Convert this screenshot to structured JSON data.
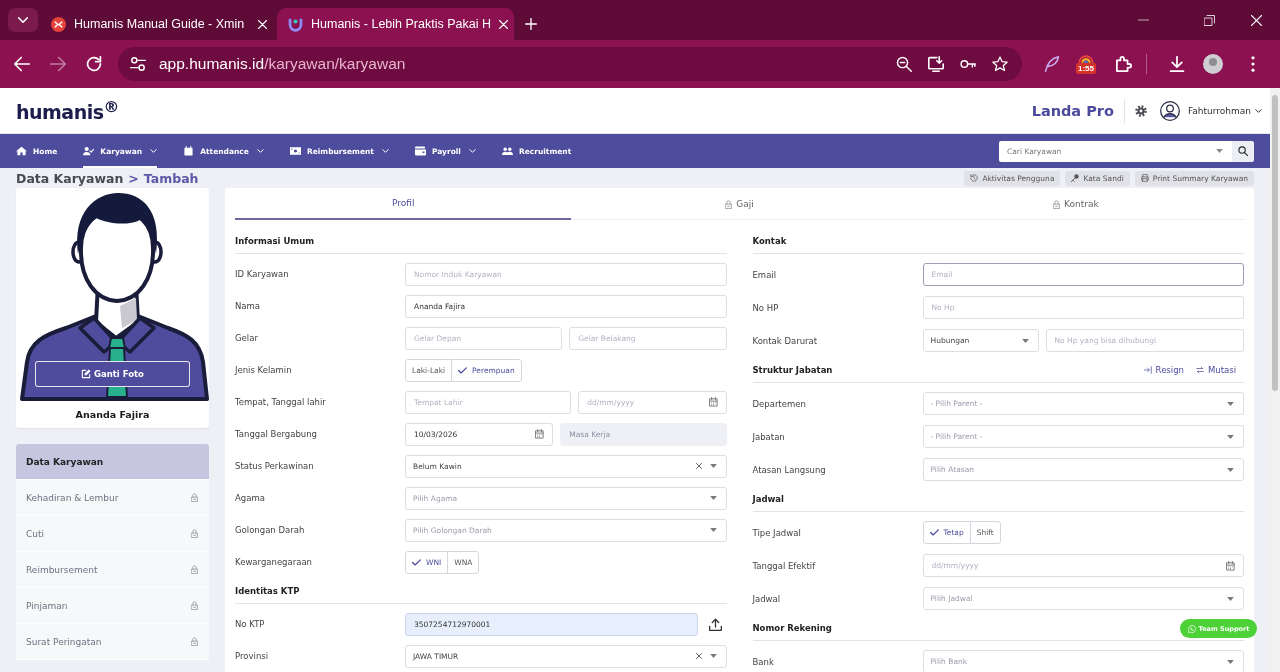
{
  "browser": {
    "tabs": [
      {
        "title": "Humanis Manual Guide - Xmin",
        "selected": false
      },
      {
        "title": "Humanis - Lebih Praktis Pakai H",
        "selected": true
      }
    ],
    "address": {
      "host": "app.humanis.id",
      "path": "/karyawan/karyawan"
    },
    "extension_badge": "1:55"
  },
  "header": {
    "logo": "humanis$^{®}$",
    "company": "Landa Pro",
    "user": "Fahturrohman"
  },
  "nav": {
    "items": [
      {
        "label": "Home",
        "selected": false,
        "has_menu": false
      },
      {
        "label": "Karyawan",
        "selected": true,
        "has_menu": true
      },
      {
        "label": "Attendance",
        "selected": false,
        "has_menu": true
      },
      {
        "label": "Reimbursement",
        "selected": false,
        "has_menu": true
      },
      {
        "label": "Payroll",
        "selected": false,
        "has_menu": true
      },
      {
        "label": "Recruitment",
        "selected": false,
        "has_menu": false
      }
    ],
    "search": {
      "placeholder": "Cari Karyawan"
    }
  },
  "breadcrumb": {
    "items": [
      "Data Karyawan",
      "Tambah"
    ],
    "separator": ">"
  },
  "page_actions": [
    "Aktivitas Pengguna",
    "Kata Sandi",
    "Print Summary Karyawan"
  ],
  "profile": {
    "photo_button": "Ganti Foto",
    "name": "Ananda Fajira"
  },
  "side_menu": [
    {
      "label": "Data Karyawan",
      "selected": true,
      "locked": false
    },
    {
      "label": "Kehadiran & Lembur",
      "selected": false,
      "locked": true
    },
    {
      "label": "Cuti",
      "selected": false,
      "locked": true
    },
    {
      "label": "Reimbursement",
      "selected": false,
      "locked": true
    },
    {
      "label": "Pinjaman",
      "selected": false,
      "locked": true
    },
    {
      "label": "Surat Peringatan",
      "selected": false,
      "locked": true
    }
  ],
  "tabs": [
    {
      "label": "Profil",
      "selected": true,
      "locked": false
    },
    {
      "label": "Gaji",
      "selected": false,
      "locked": true
    },
    {
      "label": "Kontrak",
      "selected": false,
      "locked": true
    }
  ],
  "form": {
    "columns": [
      [
        {
          "kind": "section",
          "title": "Informasi Umum"
        },
        {
          "kind": "row",
          "label": "ID Karyawan",
          "controls": [
            {
              "kind": "input",
              "placeholder": "Nomor Induk Karyawan"
            }
          ]
        },
        {
          "kind": "row",
          "label": "Nama",
          "controls": [
            {
              "kind": "input",
              "value": "Ananda Fajira"
            }
          ]
        },
        {
          "kind": "row",
          "label": "Gelar",
          "controls": [
            {
              "kind": "input",
              "placeholder": "Gelar Depan"
            },
            {
              "kind": "input",
              "placeholder": "Gelar Belakang"
            }
          ]
        },
        {
          "kind": "row",
          "label": "Jenis Kelamin",
          "controls": [
            {
              "kind": "toggle",
              "options": [
                {
                  "label": "Laki-Laki",
                  "selected": false
                },
                {
                  "label": "Perempuan",
                  "selected": true
                }
              ]
            }
          ]
        },
        {
          "kind": "row",
          "label": "Tempat, Tanggal lahir",
          "controls": [
            {
              "kind": "input",
              "placeholder": "Tempat Lahir"
            },
            {
              "kind": "date",
              "placeholder": "dd/mm/yyyy"
            }
          ]
        },
        {
          "kind": "row",
          "label": "Tanggal Bergabung",
          "controls": [
            {
              "kind": "date",
              "value": "10/03/2026"
            },
            {
              "kind": "input",
              "placeholder": "Masa Kerja",
              "disabled": true
            }
          ]
        },
        {
          "kind": "row",
          "label": "Status Perkawinan",
          "controls": [
            {
              "kind": "select",
              "value": "Belum Kawin",
              "clearable": true
            }
          ]
        },
        {
          "kind": "row",
          "label": "Agama",
          "controls": [
            {
              "kind": "select",
              "placeholder": "Pilih Agama",
              "clearable": false
            }
          ]
        },
        {
          "kind": "row",
          "label": "Golongan Darah",
          "controls": [
            {
              "kind": "select",
              "placeholder": "Pilih Golongan Darah",
              "clearable": false
            }
          ]
        },
        {
          "kind": "row",
          "label": "Kewarganegaraan",
          "controls": [
            {
              "kind": "toggle",
              "options": [
                {
                  "label": "WNI",
                  "selected": true
                },
                {
                  "label": "WNA",
                  "selected": false
                }
              ]
            }
          ]
        },
        {
          "kind": "section",
          "title": "Identitas KTP"
        },
        {
          "kind": "row",
          "label": "No KTP",
          "controls": [
            {
              "kind": "input",
              "value": "3507254712970001",
              "autofilled": true
            },
            {
              "kind": "upload"
            }
          ]
        },
        {
          "kind": "row",
          "label": "Provinsi",
          "controls": [
            {
              "kind": "select",
              "value": "JAWA TIMUR",
              "clearable": true
            }
          ]
        }
      ],
      [
        {
          "kind": "section",
          "title": "Kontak"
        },
        {
          "kind": "row",
          "label": "Email",
          "controls": [
            {
              "kind": "input",
              "placeholder": "Email",
              "focused": true
            }
          ]
        },
        {
          "kind": "row",
          "label": "No HP",
          "controls": [
            {
              "kind": "input",
              "placeholder": "No Hp"
            }
          ]
        },
        {
          "kind": "row",
          "label": "Kontak Darurat",
          "controls": [
            {
              "kind": "select",
              "value": "Hubungan",
              "clearable": false
            },
            {
              "kind": "input",
              "placeholder": "No Hp yang bisa dihubungi"
            }
          ]
        },
        {
          "kind": "section",
          "title": "Struktur Jabatan",
          "actions": [
            "Resign",
            "Mutasi"
          ]
        },
        {
          "kind": "row",
          "label": "Departemen",
          "controls": [
            {
              "kind": "select",
              "placeholder": "- Pilih Parent -",
              "clearable": false
            }
          ]
        },
        {
          "kind": "row",
          "label": "Jabatan",
          "controls": [
            {
              "kind": "select",
              "placeholder": "- Pilih Parent -",
              "clearable": false
            }
          ]
        },
        {
          "kind": "row",
          "label": "Atasan Langsung",
          "controls": [
            {
              "kind": "select",
              "placeholder": "Pilih Atasan",
              "clearable": false
            }
          ]
        },
        {
          "kind": "section",
          "title": "Jadwal"
        },
        {
          "kind": "row",
          "label": "Tipe Jadwal",
          "controls": [
            {
              "kind": "toggle",
              "options": [
                {
                  "label": "Tetap",
                  "selected": true
                },
                {
                  "label": "Shift",
                  "selected": false
                }
              ]
            }
          ]
        },
        {
          "kind": "row",
          "label": "Tanggal Efektif",
          "controls": [
            {
              "kind": "date",
              "placeholder": "dd/mm/yyyy"
            }
          ]
        },
        {
          "kind": "row",
          "label": "Jadwal",
          "controls": [
            {
              "kind": "select",
              "placeholder": "Pilih Jadwal",
              "clearable": false
            }
          ]
        },
        {
          "kind": "section",
          "title": "Nomor Rekening"
        },
        {
          "kind": "row",
          "label": "Bank",
          "controls": [
            {
              "kind": "select",
              "placeholder": "Pilih Bank",
              "clearable": false
            }
          ]
        }
      ]
    ]
  },
  "support_button": "Team Support"
}
